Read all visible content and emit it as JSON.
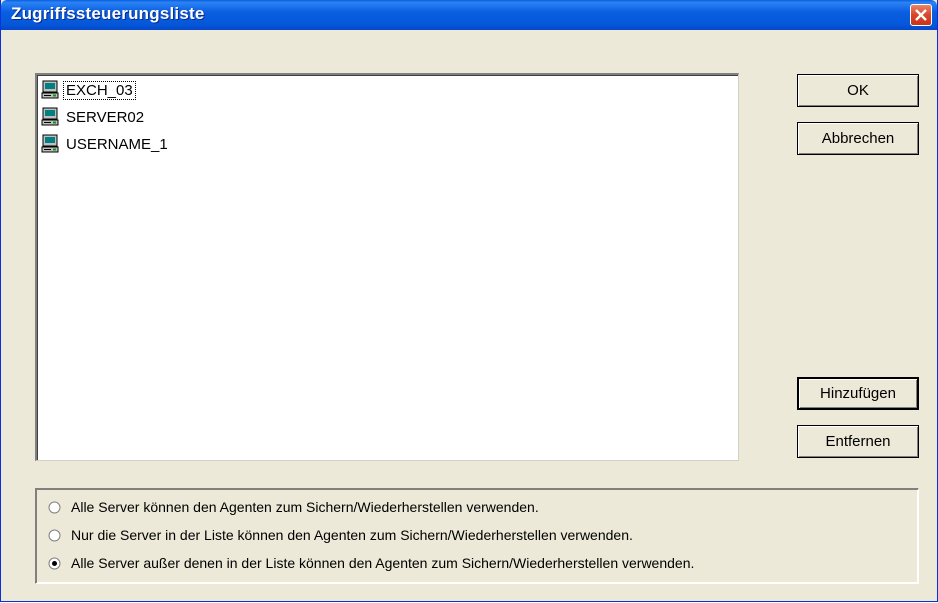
{
  "window": {
    "title": "Zugriffssteuerungsliste"
  },
  "list": {
    "items": [
      {
        "label": "EXCH_03",
        "icon": "server-icon",
        "focused": true
      },
      {
        "label": "SERVER02",
        "icon": "server-icon",
        "focused": false
      },
      {
        "label": "USERNAME_1",
        "icon": "server-icon",
        "focused": false
      }
    ]
  },
  "buttons": {
    "ok": "OK",
    "cancel": "Abbrechen",
    "add": "Hinzufügen",
    "remove": "Entfernen"
  },
  "options": {
    "items": [
      {
        "label": "Alle Server können den Agenten zum Sichern/Wiederherstellen verwenden.",
        "checked": false
      },
      {
        "label": "Nur die Server in der Liste können den Agenten zum Sichern/Wiederherstellen verwenden.",
        "checked": false
      },
      {
        "label": "Alle Server außer denen in der Liste können den Agenten zum Sichern/Wiederherstellen verwenden.",
        "checked": true
      }
    ]
  },
  "colors": {
    "titlebar": "#0a5ee0",
    "dialog_bg": "#ece9d8",
    "close_button": "#d9462a"
  }
}
